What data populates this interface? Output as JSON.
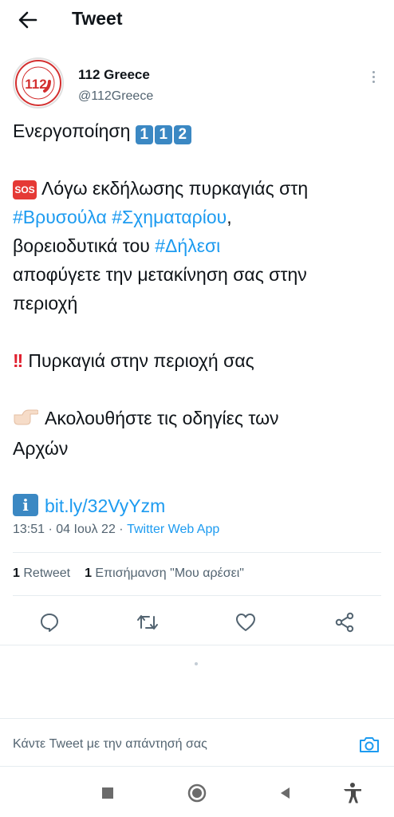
{
  "header": {
    "title": "Tweet"
  },
  "author": {
    "name": "112 Greece",
    "handle": "@112Greece",
    "avatar_text": "112"
  },
  "tweet": {
    "activation_text": "Ενεργοποίηση",
    "digits": [
      "1",
      "1",
      "2"
    ],
    "sos_label": "SOS",
    "line1": "Λόγω εκδήλωσης πυρκαγιάς στη",
    "hashtag1": "#Βρυσούλα",
    "hashtag2": "#Σχηματαρίου",
    "comma": ",",
    "line2": "βορειοδυτικά του",
    "hashtag3": "#Δήλεσι",
    "line3": "αποφύγετε την μετακίνηση σας στην",
    "line4": "περιοχή",
    "bang": "!!",
    "line5": "Πυρκαγιά στην περιοχή σας",
    "line6": "Ακολουθήστε τις οδηγίες των",
    "line7": "Αρχών",
    "info_label": "i",
    "link": "bit.ly/32VyYzm"
  },
  "meta": {
    "time": "13:51",
    "date": "04 Ιουλ 22",
    "separator": " · ",
    "source": "Twitter Web App"
  },
  "stats": {
    "retweets_count": "1",
    "retweets_label": "Retweet",
    "likes_count": "1",
    "likes_label": "Επισήμανση \"Μου αρέσει\""
  },
  "reply": {
    "placeholder": "Κάντε Tweet με την απάντησή σας"
  },
  "colors": {
    "link": "#1d9bf0",
    "keycap": "#3b88c3",
    "sos": "#e53935",
    "secondary_text": "#536471"
  },
  "icons": [
    "back-arrow-icon",
    "more-vertical-icon",
    "reply-icon",
    "retweet-icon",
    "like-icon",
    "share-icon",
    "camera-icon",
    "nav-recents-icon",
    "nav-home-icon",
    "nav-back-icon",
    "accessibility-icon"
  ]
}
